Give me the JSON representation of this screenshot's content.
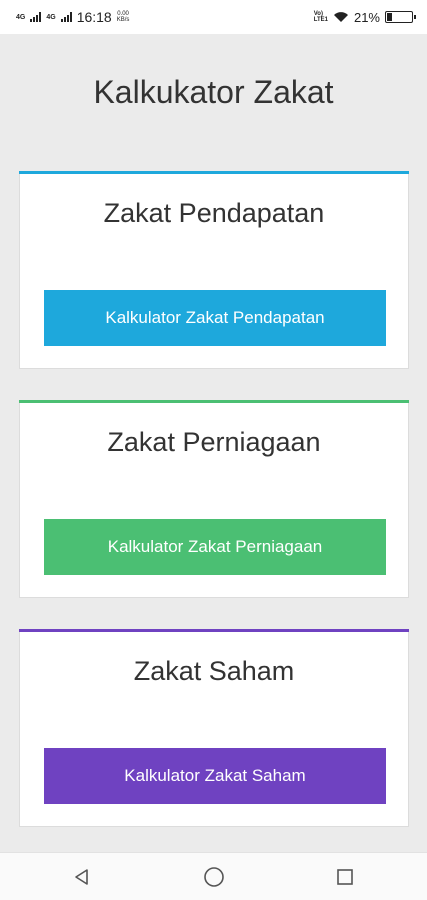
{
  "status_bar": {
    "network_1": "4G",
    "network_2": "4G",
    "time": "16:18",
    "speed_value": "0.00",
    "speed_unit": "KB/s",
    "volte_line1": "Vo)",
    "volte_line2": "LTE1",
    "battery_percent": "21%",
    "battery_level": 0.21,
    "icons": [
      "signal-icon",
      "wifi-icon",
      "battery-icon"
    ]
  },
  "page": {
    "title": "Kalkukator Zakat"
  },
  "cards": [
    {
      "title": "Zakat Pendapatan",
      "button_label": "Kalkulator Zakat Pendapatan",
      "color": "#1ea8dc"
    },
    {
      "title": "Zakat Perniagaan",
      "button_label": "Kalkulator Zakat Perniagaan",
      "color": "#4bbf73"
    },
    {
      "title": "Zakat Saham",
      "button_label": "Kalkulator Zakat Saham",
      "color": "#6f42c1"
    }
  ],
  "nav_bar": {
    "icons": [
      "back-icon",
      "home-icon",
      "recents-icon"
    ]
  }
}
